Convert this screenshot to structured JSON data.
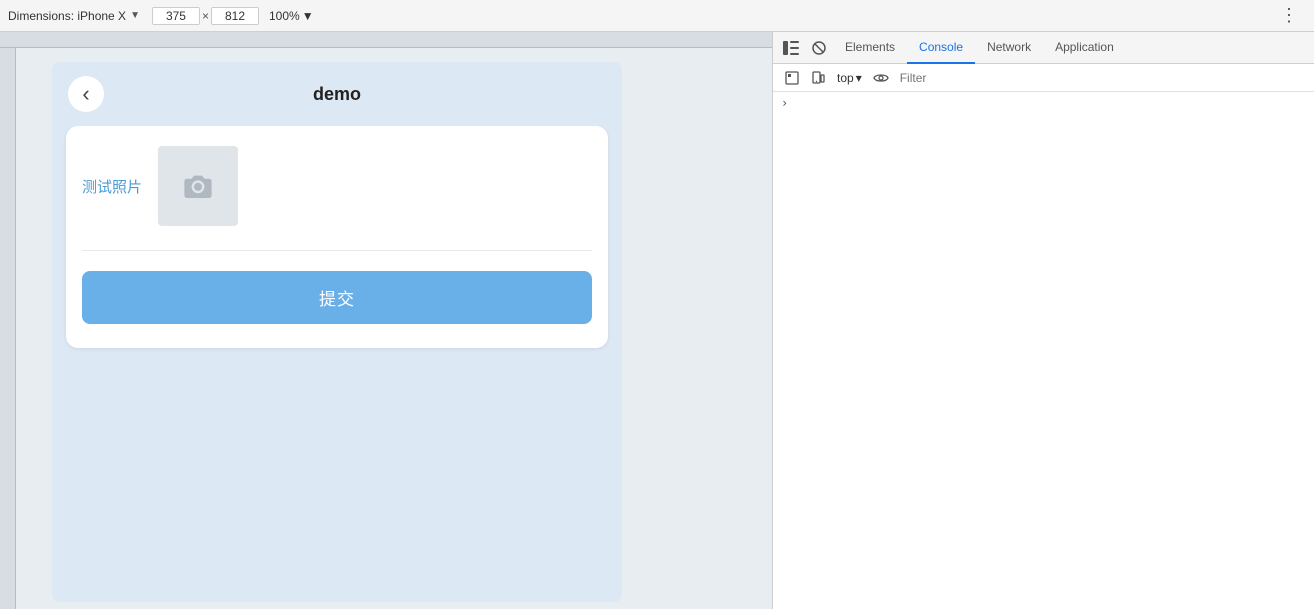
{
  "toolbar": {
    "device_label": "Dimensions: iPhone X",
    "device_chevron": "▼",
    "width": "375",
    "height": "812",
    "dim_separator": "×",
    "zoom": "100%",
    "zoom_chevron": "▼",
    "dots": "⋮"
  },
  "devtools": {
    "tabs": [
      {
        "id": "elements",
        "label": "Elements",
        "active": false
      },
      {
        "id": "console",
        "label": "Console",
        "active": true
      },
      {
        "id": "network",
        "label": "Network",
        "active": false
      },
      {
        "id": "application",
        "label": "Application",
        "active": false
      }
    ],
    "console_toolbar": {
      "top_label": "top",
      "top_chevron": "▾",
      "filter_placeholder": "Filter"
    },
    "console_content": {
      "chevron": "›"
    }
  },
  "app": {
    "back_icon": "‹",
    "title": "demo",
    "photo_label": "测试照片",
    "submit_label": "提交"
  },
  "icons": {
    "sidebar_icon": "▣",
    "block_icon": "⊘",
    "eye_icon": "◉",
    "inspect_icon": "⊡",
    "device_icon": "⊟"
  }
}
